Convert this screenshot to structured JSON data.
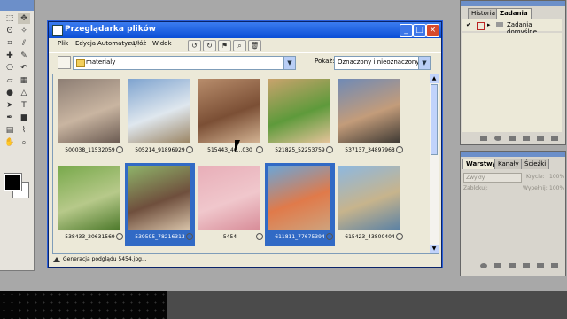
{
  "file_browser": {
    "title": "Przeglądarka plików",
    "menu": [
      "Plik",
      "Edycja",
      "Automatyzuj",
      "Ułóż",
      "Widok"
    ],
    "folder": "materialy",
    "show_label": "Pokaż:",
    "show_value": "Oznaczony i nieoznaczony",
    "thumbnails": [
      {
        "caption": "500038_11532059",
        "selected": false,
        "colors": [
          "#8d7e74",
          "#c9b5a1",
          "#6b5b52"
        ]
      },
      {
        "caption": "505214_91896929",
        "selected": false,
        "colors": [
          "#7ea3cf",
          "#dfe7ee",
          "#9b8564"
        ]
      },
      {
        "caption": "515443_46...030",
        "selected": false,
        "colors": [
          "#b88d6c",
          "#7b4f35",
          "#d3b393"
        ]
      },
      {
        "caption": "521825_52253759",
        "selected": false,
        "colors": [
          "#c9a36d",
          "#5e9a3b",
          "#e5c39a"
        ]
      },
      {
        "caption": "537137_34897968",
        "selected": false,
        "colors": [
          "#6f8ab6",
          "#c39c7a",
          "#3f3a34"
        ]
      },
      {
        "caption": "538433_20631569",
        "selected": false,
        "colors": [
          "#78a94b",
          "#b7c98a",
          "#4e7a2c"
        ]
      },
      {
        "caption": "539595_78216313",
        "selected": true,
        "colors": [
          "#8fb46a",
          "#6f4f3d",
          "#d7c2a8"
        ]
      },
      {
        "caption": "5454",
        "selected": false,
        "colors": [
          "#e8aeb8",
          "#f0c7cc",
          "#d88d99"
        ]
      },
      {
        "caption": "611811_77675394",
        "selected": true,
        "colors": [
          "#6aa6d9",
          "#e07a4a",
          "#cfa27c"
        ]
      },
      {
        "caption": "615423_43800404",
        "selected": false,
        "colors": [
          "#8db8e0",
          "#c7b48c",
          "#5c82a4"
        ]
      }
    ],
    "status": "Generacja podglądu 5454.jpg..."
  },
  "history_panel": {
    "tabs": [
      "Historia",
      "Zadania"
    ],
    "active_tab": "Zadania",
    "item": "Zadania domyślne"
  },
  "layers_panel": {
    "tabs": [
      "Warstwy",
      "Kanały",
      "Ścieżki"
    ],
    "active_tab": "Warstwy",
    "blend_mode": "Zwykły",
    "opacity_label": "Krycie:",
    "opacity_value": "100%",
    "lock_label": "Zablokuj:",
    "fill_label": "Wypełnij:",
    "fill_value": "100%"
  },
  "tools": [
    "marquee-icon",
    "move-icon",
    "lasso-icon",
    "magic-wand-icon",
    "crop-icon",
    "slice-icon",
    "healing-icon",
    "brush-icon",
    "stamp-icon",
    "history-brush-icon",
    "eraser-icon",
    "gradient-icon",
    "dodge-icon",
    "sharpen-icon",
    "path-select-icon",
    "type-icon",
    "pen-icon",
    "shape-icon",
    "notes-icon",
    "eyedropper-icon",
    "hand-icon",
    "zoom-icon"
  ]
}
